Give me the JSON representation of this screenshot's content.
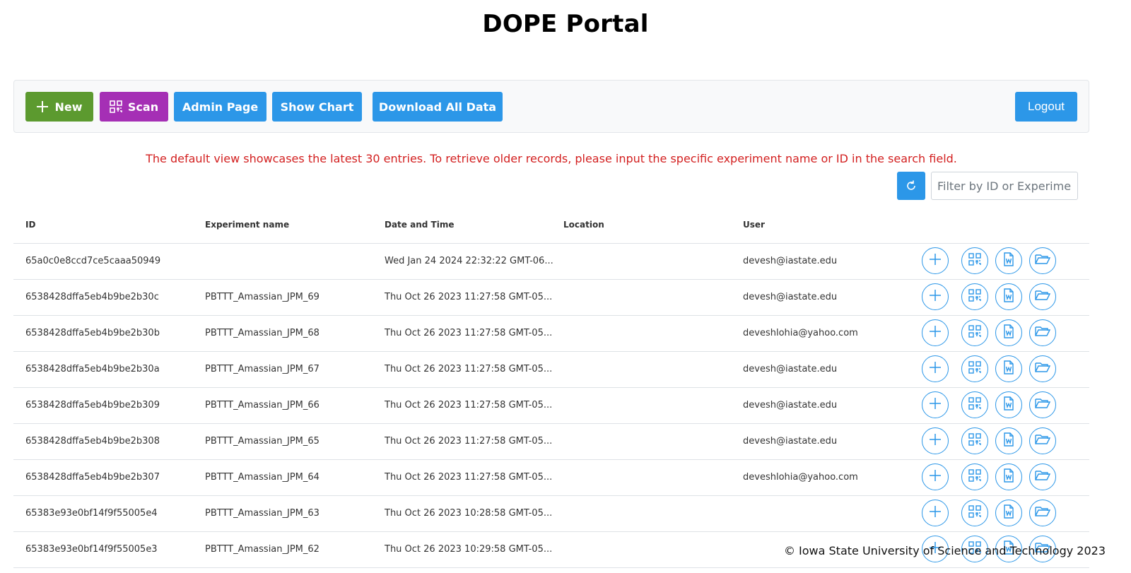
{
  "page": {
    "title": "DOPE Portal",
    "footer": "© Iowa State University of Science and Technology 2023",
    "notice": "The default view showcases the latest 30 entries. To retrieve older records, please input the specific experiment name or ID in the search field."
  },
  "toolbar": {
    "new_label": "New",
    "scan_label": "Scan",
    "admin_label": "Admin Page",
    "chart_label": "Show Chart",
    "download_label": "Download All Data",
    "logout_label": "Logout"
  },
  "search": {
    "placeholder": "Filter by ID or Experiment"
  },
  "colors": {
    "new_button": "#5c9a2f",
    "scan_button": "#a52fb5",
    "primary": "#2c97e8",
    "notice": "#d32020"
  },
  "table": {
    "columns": [
      "ID",
      "Experiment name",
      "Date and Time",
      "Location",
      "User"
    ],
    "rows": [
      {
        "id": "65a0c0e8ccd7ce5caaa50949",
        "experiment": "",
        "datetime": "Wed Jan 24 2024 22:32:22 GMT-06...",
        "location": "",
        "user": "devesh@iastate.edu"
      },
      {
        "id": "6538428dffa5eb4b9be2b30c",
        "experiment": "PBTTT_Amassian_JPM_69",
        "datetime": "Thu Oct 26 2023 11:27:58 GMT-05...",
        "location": "",
        "user": "devesh@iastate.edu"
      },
      {
        "id": "6538428dffa5eb4b9be2b30b",
        "experiment": "PBTTT_Amassian_JPM_68",
        "datetime": "Thu Oct 26 2023 11:27:58 GMT-05...",
        "location": "",
        "user": "deveshlohia@yahoo.com"
      },
      {
        "id": "6538428dffa5eb4b9be2b30a",
        "experiment": "PBTTT_Amassian_JPM_67",
        "datetime": "Thu Oct 26 2023 11:27:58 GMT-05...",
        "location": "",
        "user": "devesh@iastate.edu"
      },
      {
        "id": "6538428dffa5eb4b9be2b309",
        "experiment": "PBTTT_Amassian_JPM_66",
        "datetime": "Thu Oct 26 2023 11:27:58 GMT-05...",
        "location": "",
        "user": "devesh@iastate.edu"
      },
      {
        "id": "6538428dffa5eb4b9be2b308",
        "experiment": "PBTTT_Amassian_JPM_65",
        "datetime": "Thu Oct 26 2023 11:27:58 GMT-05...",
        "location": "",
        "user": "devesh@iastate.edu"
      },
      {
        "id": "6538428dffa5eb4b9be2b307",
        "experiment": "PBTTT_Amassian_JPM_64",
        "datetime": "Thu Oct 26 2023 11:27:58 GMT-05...",
        "location": "",
        "user": "deveshlohia@yahoo.com"
      },
      {
        "id": "65383e93e0bf14f9f55005e4",
        "experiment": "PBTTT_Amassian_JPM_63",
        "datetime": "Thu Oct 26 2023 10:28:58 GMT-05...",
        "location": "",
        "user": ""
      },
      {
        "id": "65383e93e0bf14f9f55005e3",
        "experiment": "PBTTT_Amassian_JPM_62",
        "datetime": "Thu Oct 26 2023 10:29:58 GMT-05...",
        "location": "",
        "user": ""
      }
    ],
    "row_actions": [
      "plus-icon",
      "qr-code-icon",
      "word-document-icon",
      "folder-open-icon"
    ]
  }
}
